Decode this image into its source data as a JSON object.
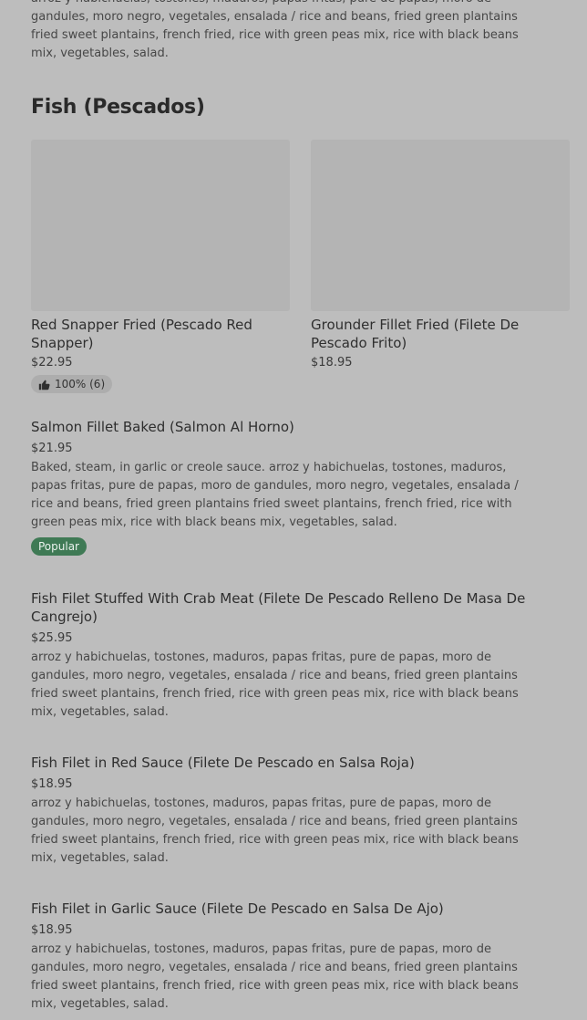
{
  "top_item": {
    "description": "arroz y habichuelas, tostones, maduros, papas fritas, pure de papas, moro de gandules, moro negro, vegetales, ensalada / rice and beans, fried green plantains fried sweet plantains, french fried, rice with green peas mix, rice with black beans mix, vegetables, salad."
  },
  "section": {
    "title": "Fish (Pescados)"
  },
  "featured": [
    {
      "name": "Red Snapper Fried (Pescado Red Snapper)",
      "price": "$22.95",
      "rating": "100% (6)"
    },
    {
      "name": "Grounder Fillet Fried (Filete De Pescado Frito)",
      "price": "$18.95"
    }
  ],
  "items": [
    {
      "name": "Salmon Fillet Baked (Salmon Al Horno)",
      "price": "$21.95",
      "description": "Baked, steam, in garlic or creole sauce. arroz y habichuelas, tostones, maduros, papas fritas, pure de papas, moro de gandules, moro negro, vegetales, ensalada / rice and beans, fried green plantains fried sweet plantains, french fried, rice with green peas mix, rice with black beans mix, vegetables, salad.",
      "badge": "Popular"
    },
    {
      "name": "Fish Filet Stuffed With Crab Meat (Filete De Pescado Relleno De Masa De Cangrejo)",
      "price": "$25.95",
      "description": "arroz y habichuelas, tostones, maduros, papas fritas, pure de papas, moro de gandules, moro negro, vegetales, ensalada / rice and beans, fried green plantains fried sweet plantains, french fried, rice with green peas mix, rice with black beans mix, vegetables, salad."
    },
    {
      "name": "Fish Filet in Red Sauce (Filete De Pescado en Salsa Roja)",
      "price": "$18.95",
      "description": "arroz y habichuelas, tostones, maduros, papas fritas, pure de papas, moro de gandules, moro negro, vegetales, ensalada / rice and beans, fried green plantains fried sweet plantains, french fried, rice with green peas mix, rice with black beans mix, vegetables, salad."
    },
    {
      "name": "Fish Filet in Garlic Sauce (Filete De Pescado en Salsa De Ajo)",
      "price": "$18.95",
      "description": "arroz y habichuelas, tostones, maduros, papas fritas, pure de papas, moro de gandules, moro negro, vegetales, ensalada / rice and beans, fried green plantains fried sweet plantains, french fried, rice with green peas mix, rice with black beans mix, vegetables, salad."
    }
  ],
  "colors": {
    "background": "#bdbdbd",
    "popular_badge": "#3f7a55",
    "image_placeholder": "#b4b4b4"
  }
}
